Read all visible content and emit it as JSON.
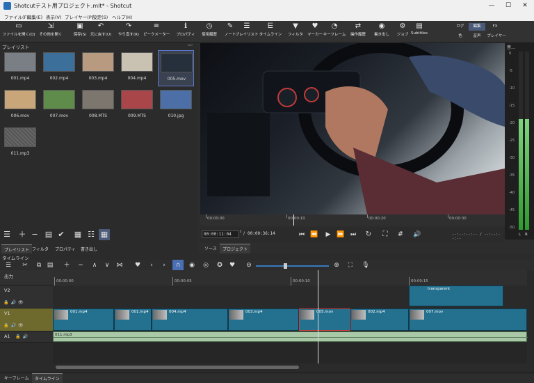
{
  "window": {
    "title": "Shotcutテスト用プロジェクト.mlt* - Shotcut",
    "minimize": "—",
    "maximize": "☐",
    "close": "✕"
  },
  "menu": [
    "ファイル(F)",
    "編集(E)",
    "表示(V)",
    "プレイヤー(P)",
    "設定(S)",
    "ヘルプ(H)"
  ],
  "toolbar": {
    "buttons": [
      {
        "label": "ファイルを開く(O)",
        "icon": "folder-icon",
        "glyph": "▭"
      },
      {
        "label": "その他を開く",
        "icon": "open-other-icon",
        "glyph": "⇲"
      },
      {
        "label": "保存(S)",
        "icon": "save-icon",
        "glyph": "▣"
      },
      {
        "label": "元に戻す(U)",
        "icon": "undo-icon",
        "glyph": "↶"
      },
      {
        "label": "やり直す(R)",
        "icon": "redo-icon",
        "glyph": "↷"
      },
      {
        "label": "ピークメーター",
        "icon": "peak-meter-icon",
        "glyph": "≡"
      },
      {
        "label": "プロパティ",
        "icon": "info-icon",
        "glyph": "ℹ"
      },
      {
        "label": "使用履歴",
        "icon": "history-icon",
        "glyph": "◷"
      },
      {
        "label": "ノート",
        "icon": "note-icon",
        "glyph": "✎"
      },
      {
        "label": "プレイリスト",
        "icon": "playlist-icon",
        "glyph": "☰"
      },
      {
        "label": "タイムライン",
        "icon": "timeline-icon",
        "glyph": "⋿"
      },
      {
        "label": "フィルタ",
        "icon": "filter-icon",
        "glyph": "▼"
      },
      {
        "label": "マーカー",
        "icon": "marker-icon",
        "glyph": "♥"
      },
      {
        "label": "キーフレーム",
        "icon": "keyframe-icon",
        "glyph": "◔"
      },
      {
        "label": "操作履歴",
        "icon": "action-history-icon",
        "glyph": "⇄"
      },
      {
        "label": "書き出し",
        "icon": "export-icon",
        "glyph": "◉"
      },
      {
        "label": "ジョブ",
        "icon": "jobs-icon",
        "glyph": "⚙"
      },
      {
        "label": "Subtitles",
        "icon": "subtitles-icon",
        "glyph": "▤"
      }
    ],
    "layouts": {
      "log": "ログ",
      "edit": "編集",
      "fx": "FX",
      "color": "色",
      "audio": "音声",
      "player": "プレイヤー"
    }
  },
  "playlist": {
    "title": "プレイリスト",
    "items": [
      {
        "name": "001.mp4",
        "color": "#7a7f86"
      },
      {
        "name": "002.mp4",
        "color": "#3c6f9a"
      },
      {
        "name": "003.mp4",
        "color": "#b89a80"
      },
      {
        "name": "004.mp4",
        "color": "#c9c2b2"
      },
      {
        "name": "005.mov",
        "color": "#26303c"
      },
      {
        "name": "006.mov",
        "color": "#c8a679"
      },
      {
        "name": "007.mov",
        "color": "#5f8c4a"
      },
      {
        "name": "008.MTS",
        "color": "#7d766e"
      },
      {
        "name": "009.MTS",
        "color": "#a8464a"
      },
      {
        "name": "010.jpg",
        "color": "#4b6fa6"
      },
      {
        "name": "011.mp3",
        "color": "#5a5a5a"
      }
    ],
    "tabs": [
      "プレイリスト",
      "フィルタ",
      "プロパティ",
      "書き出し"
    ]
  },
  "player": {
    "ruler": [
      "00:00:00",
      "00:00:10",
      "00:00:20",
      "00:00:30"
    ],
    "current_time": "00:00:11:04",
    "separator": "/",
    "duration": "00:00:36:14",
    "in_out": "--:--:--:-- / --:--:--:--",
    "tabs": [
      "ソース",
      "プロジェクト"
    ]
  },
  "meter": {
    "title": "音…",
    "scale": [
      "0",
      "-5",
      "-10",
      "-15",
      "-20",
      "-25",
      "-30",
      "-35",
      "-40",
      "-45",
      "-50"
    ],
    "channels": [
      "L",
      "R"
    ],
    "level_db": -19
  },
  "timeline": {
    "title": "タイムライン",
    "output_label": "出力",
    "ruler": [
      "00:00:00",
      "00:00:05",
      "00:00:10",
      "00:00:15"
    ],
    "tracks": {
      "v2": "V2",
      "v1": "V1",
      "a1": "A1"
    },
    "v2_clip": "transparent",
    "v1_clips": [
      "001.mp4",
      "001.mp4",
      "004.mp4",
      "003.mp4",
      "005.mov",
      "002.mp4",
      "007.mov"
    ],
    "a1_clip": "011.mp3"
  },
  "bottom_tabs": [
    "キーフレーム",
    "タイムライン"
  ]
}
